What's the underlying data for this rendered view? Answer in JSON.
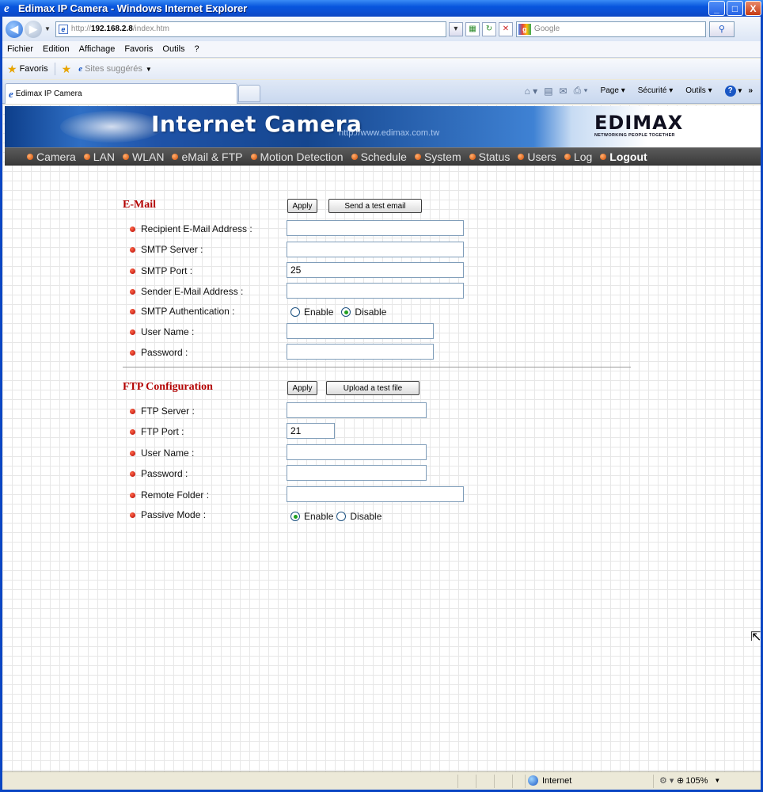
{
  "window": {
    "title": "Edimax IP Camera - Windows Internet Explorer",
    "minimize": "_",
    "maximize": "□",
    "close": "X"
  },
  "address_bar": {
    "url_prefix": "http://",
    "url_host": "192.168.2.8",
    "url_path": "/index.htm",
    "search_placeholder": "Google"
  },
  "menu": [
    "Fichier",
    "Edition",
    "Affichage",
    "Favoris",
    "Outils",
    "?"
  ],
  "favorites_bar": {
    "favorites_label": "Favoris",
    "suggested_label": "Sites suggérés"
  },
  "tab": {
    "label": "Edimax IP Camera"
  },
  "command_bar": {
    "page_label": "Page",
    "security_label": "Sécurité",
    "tools_label": "Outils"
  },
  "banner": {
    "title": "Internet Camera",
    "url": "http://www.edimax.com.tw",
    "logo": "EDIMAX",
    "tagline": "NETWORKING PEOPLE TOGETHER"
  },
  "nav": [
    "Camera",
    "LAN",
    "WLAN",
    "eMail & FTP",
    "Motion Detection",
    "Schedule",
    "System",
    "Status",
    "Users",
    "Log",
    "Logout"
  ],
  "email": {
    "title": "E-Mail",
    "apply_label": "Apply",
    "test_label": "Send a test email",
    "recipient_label": "Recipient E-Mail Address :",
    "recipient_value": "",
    "smtp_server_label": "SMTP Server :",
    "smtp_server_value": "",
    "smtp_port_label": "SMTP Port :",
    "smtp_port_value": "25",
    "sender_label": "Sender E-Mail Address :",
    "sender_value": "",
    "auth_label": "SMTP Authentication :",
    "auth_enable": "Enable",
    "auth_disable": "Disable",
    "auth_selected": "Disable",
    "username_label": "User Name :",
    "username_value": "",
    "password_label": "Password :",
    "password_value": ""
  },
  "ftp": {
    "title": "FTP Configuration",
    "apply_label": "Apply",
    "test_label": "Upload a test file",
    "server_label": "FTP Server :",
    "server_value": "",
    "port_label": "FTP Port :",
    "port_value": "21",
    "username_label": "User Name :",
    "username_value": "",
    "password_label": "Password :",
    "password_value": "",
    "folder_label": "Remote Folder :",
    "folder_value": "",
    "passive_label": "Passive Mode :",
    "passive_enable": "Enable",
    "passive_disable": "Disable",
    "passive_selected": "Enable"
  },
  "status_bar": {
    "zone": "Internet",
    "zoom": "105%"
  }
}
